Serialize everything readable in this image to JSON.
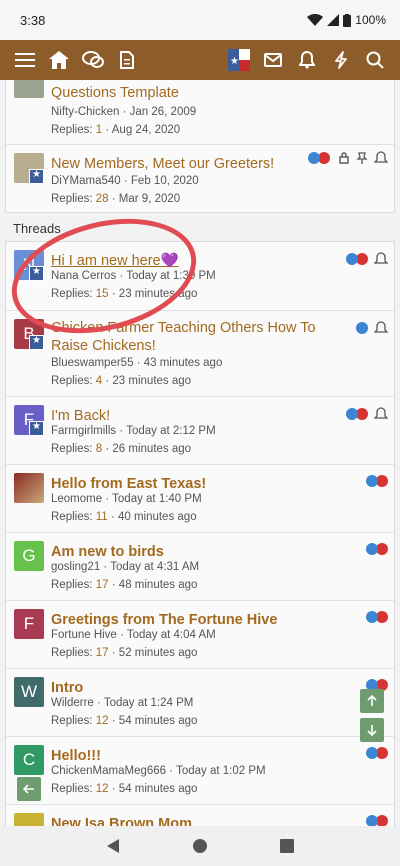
{
  "status": {
    "time": "3:38",
    "battery": "100%"
  },
  "nav": {
    "icons": [
      "menu-icon",
      "home-icon",
      "forums-icon",
      "document-icon",
      "profile-avatar",
      "mail-icon",
      "bell-icon",
      "bolt-icon",
      "search-icon"
    ]
  },
  "sticky_threads": [
    {
      "title": "Questions Template",
      "author": "Nifty-Chicken",
      "date": "Jan 26, 2009",
      "replies_label": "Replies:",
      "replies": "1",
      "last": "Aug 24, 2020"
    },
    {
      "title": "New Members, Meet our Greeters!",
      "author": "DiYMama540",
      "date": "Feb 10, 2020",
      "replies_label": "Replies:",
      "replies": "28",
      "last": "Mar 9, 2020"
    }
  ],
  "section_title": "Threads",
  "threads": [
    {
      "title": "Hi I am new here💜",
      "author": "Nana Cerros",
      "date": "Today at 1:30 PM",
      "replies_label": "Replies:",
      "replies": "15",
      "last": "23 minutes ago",
      "avatar": "N",
      "avatar_color": "#6b8fd6"
    },
    {
      "title": "Chicken Farmer Teaching Others How To Raise Chickens!",
      "author": "Blueswamper55",
      "date": "43 minutes ago",
      "replies_label": "Replies:",
      "replies": "4",
      "last": "23 minutes ago",
      "avatar": "B",
      "avatar_color": "#a83a46"
    },
    {
      "title": "I'm Back!",
      "author": "Farmgirlmills",
      "date": "Today at 2:12 PM",
      "replies_label": "Replies:",
      "replies": "8",
      "last": "26 minutes ago",
      "avatar": "F",
      "avatar_color": "#6a5fc9"
    },
    {
      "title": "Hello from East Texas!",
      "author": "Leomome",
      "date": "Today at 1:40 PM",
      "replies_label": "Replies:",
      "replies": "11",
      "last": "40 minutes ago",
      "avatar": "",
      "avatar_color": "#8a2b22"
    },
    {
      "title": "Am new to birds",
      "author": "gosling21",
      "date": "Today at 4:31 AM",
      "replies_label": "Replies:",
      "replies": "17",
      "last": "48 minutes ago",
      "avatar": "G",
      "avatar_color": "#66c24a"
    },
    {
      "title": "Greetings from The Fortune Hive",
      "author": "Fortune Hive",
      "date": "Today at 4:04 AM",
      "replies_label": "Replies:",
      "replies": "17",
      "last": "52 minutes ago",
      "avatar": "F",
      "avatar_color": "#a83a52"
    },
    {
      "title": "Intro",
      "author": "Wilderre",
      "date": "Today at 1:24 PM",
      "replies_label": "Replies:",
      "replies": "12",
      "last": "54 minutes ago",
      "avatar": "W",
      "avatar_color": "#3f6b6b"
    },
    {
      "title": "Hello!!!",
      "author": "ChickenMamaMeg666",
      "date": "Today at 1:02 PM",
      "replies_label": "Replies:",
      "replies": "12",
      "last": "54 minutes ago",
      "avatar": "C",
      "avatar_color": "#2f9a63"
    },
    {
      "title": "New Isa Brown Mom",
      "author": "",
      "date": "",
      "replies_label": "",
      "replies": "",
      "last": "",
      "avatar": "",
      "avatar_color": "#c9b233"
    }
  ],
  "colors": {
    "nav_bg": "#8c5d2a",
    "title_link": "#a36a1f",
    "annotation": "#e14c52",
    "scroll_btn": "#6e9c6e"
  }
}
